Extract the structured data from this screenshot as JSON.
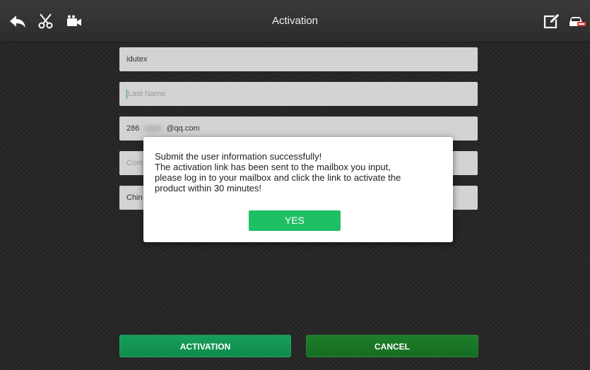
{
  "header": {
    "title": "Activation",
    "icons": [
      "back-icon",
      "scissors-icon",
      "video-camera-icon",
      "edit-icon",
      "car-icon"
    ]
  },
  "form": {
    "first_name": "idutex",
    "last_name_placeholder": "Last Name",
    "email_prefix": "286",
    "email_suffix": "@qq.com",
    "company_partial": "Com",
    "country_partial": "Chin"
  },
  "dialog": {
    "lines": [
      "Submit the user information successfully!",
      "The activation link has been sent to the mailbox you input,",
      "please log in to your mailbox and click the link to activate the",
      "product within 30 minutes!"
    ],
    "yes_label": "YES"
  },
  "buttons": {
    "activation_label": "ACTIVATION",
    "cancel_label": "CANCEL"
  },
  "colors": {
    "accent": "#1fbf63",
    "activation": "#13975a",
    "cancel": "#1b7a26"
  }
}
